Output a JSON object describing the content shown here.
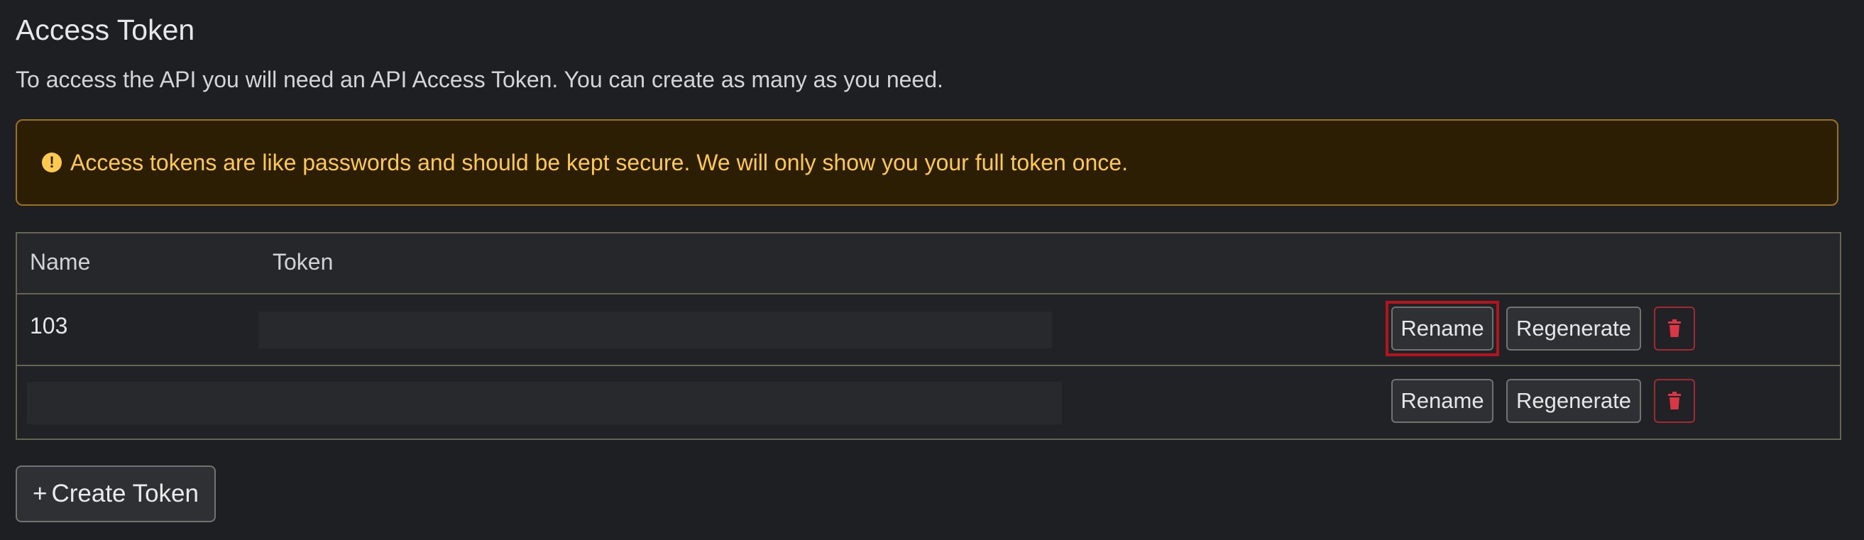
{
  "header": {
    "title": "Access Token",
    "description": "To access the API you will need an API Access Token. You can create as many as you need."
  },
  "alert": {
    "icon": "exclamation-circle-icon",
    "icon_glyph": "!",
    "text": "Access tokens are like passwords and should be kept secure. We will only show you your full token once.",
    "color": "#ffc94d"
  },
  "table": {
    "columns": [
      "Name",
      "Token"
    ],
    "rows": [
      {
        "name": "103",
        "token": "",
        "actions": {
          "rename": "Rename",
          "regenerate": "Regenerate",
          "delete_icon": "trash-icon"
        }
      },
      {
        "name": "",
        "token": "",
        "actions": {
          "rename": "Rename",
          "regenerate": "Regenerate",
          "delete_icon": "trash-icon"
        }
      }
    ]
  },
  "footer": {
    "create_plus": "+",
    "create_label": "Create Token"
  },
  "colors": {
    "background": "#1e1f22",
    "danger": "#dc3545",
    "highlight": "#b3141f"
  }
}
